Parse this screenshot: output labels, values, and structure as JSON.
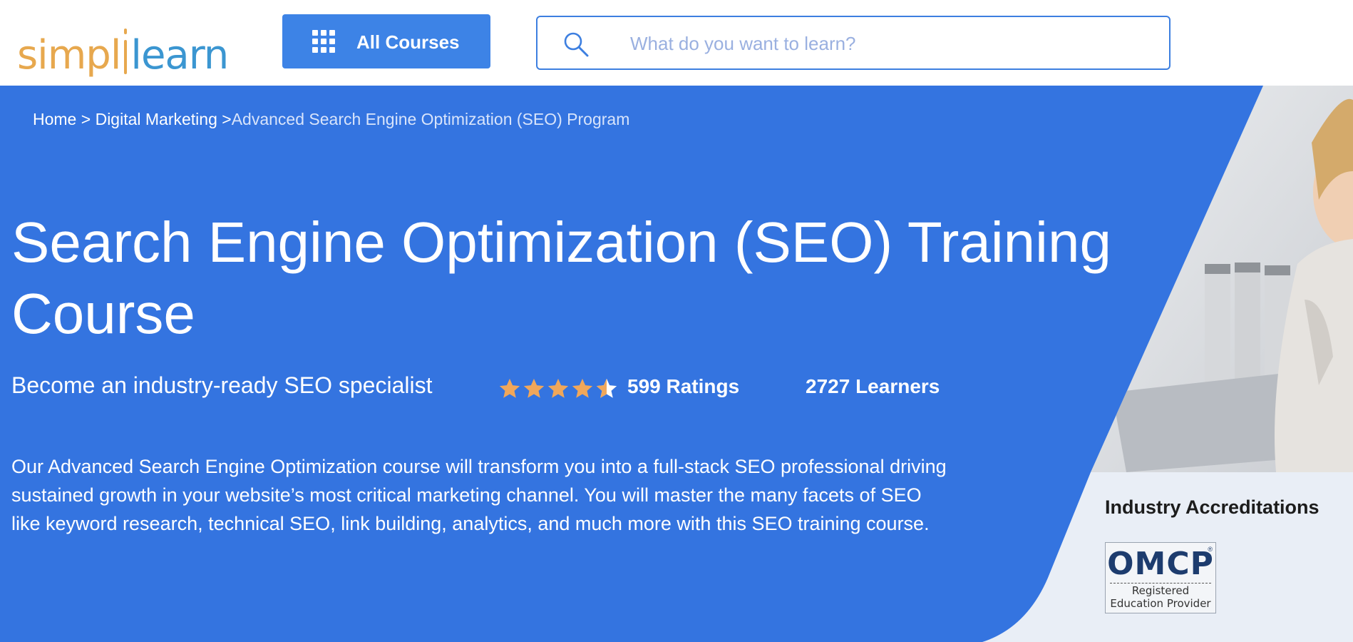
{
  "header": {
    "logo": {
      "part1": "simpl",
      "part2": "learn"
    },
    "all_courses_label": "All Courses",
    "search": {
      "placeholder": "What do you want to learn?",
      "value": ""
    }
  },
  "breadcrumb": {
    "home": "Home",
    "sep1": " > ",
    "category": "Digital Marketing",
    "sep2": " >",
    "current": "Advanced Search Engine Optimization (SEO) Program"
  },
  "course": {
    "title": "Search Engine Optimization (SEO) Training Course",
    "subtitle": "Become an industry-ready SEO specialist",
    "rating_stars": 4.5,
    "ratings_label": "599 Ratings",
    "learners_label": "2727 Learners",
    "description": "Our Advanced Search Engine Optimization course will transform you into a full-stack SEO professional driving sustained growth in your website’s most critical marketing channel. You will master the many facets of SEO like keyword research, technical SEO, link building, analytics, and much more with this SEO training course."
  },
  "accreditations": {
    "title": "Industry Accreditations",
    "badge": {
      "name": "OMCP",
      "line1": "Registered",
      "line2": "Education Provider"
    }
  },
  "colors": {
    "hero_blue": "#3474e0",
    "button_blue": "#3d83e6",
    "star_orange": "#f0a75a",
    "logo_orange": "#e7a84e",
    "logo_blue": "#3b96d1"
  },
  "icons": {
    "grid": "grid-icon",
    "search": "search-icon",
    "star": "star-icon"
  }
}
